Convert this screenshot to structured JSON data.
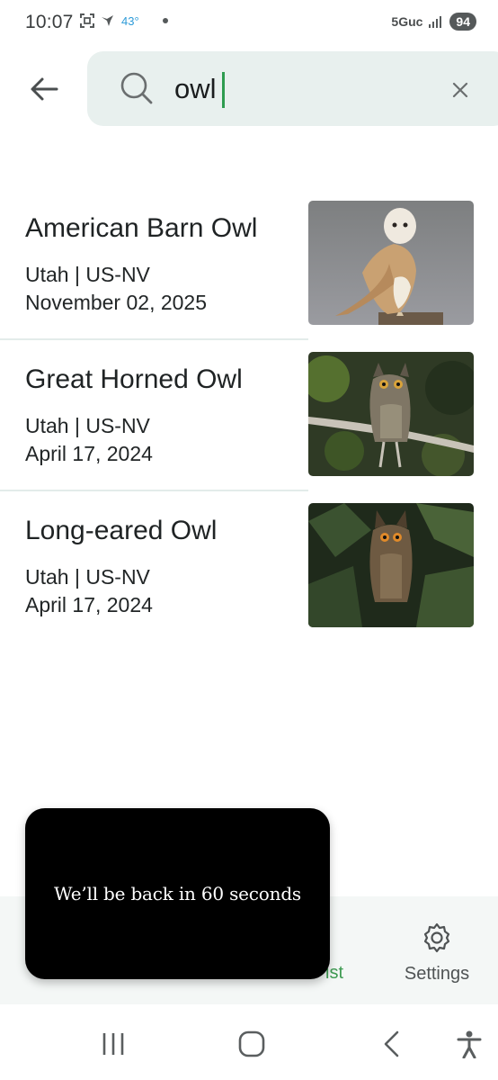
{
  "status_bar": {
    "time": "10:07",
    "temperature": "43°",
    "network": "5Guc",
    "battery": "94"
  },
  "search": {
    "query": "owl",
    "placeholder": ""
  },
  "results": [
    {
      "name": "American Barn Owl",
      "location": "Utah | US-NV",
      "date": "November 02, 2025",
      "image": "barn-owl-photo"
    },
    {
      "name": "Great Horned Owl",
      "location": "Utah | US-NV",
      "date": "April 17, 2024",
      "image": "great-horned-owl-photo"
    },
    {
      "name": "Long-eared Owl",
      "location": "Utah | US-NV",
      "date": "April 17, 2024",
      "image": "long-eared-owl-photo"
    }
  ],
  "bottom_nav": {
    "settings_label": "Settings",
    "list_label_visible": "ist",
    "left_label_visible": ""
  },
  "toast": {
    "message": "We’ll be back in 60 seconds"
  },
  "colors": {
    "accent": "#2e9c4f",
    "search_bg": "#e8f0ee",
    "nav_bg": "#f4f7f6"
  }
}
